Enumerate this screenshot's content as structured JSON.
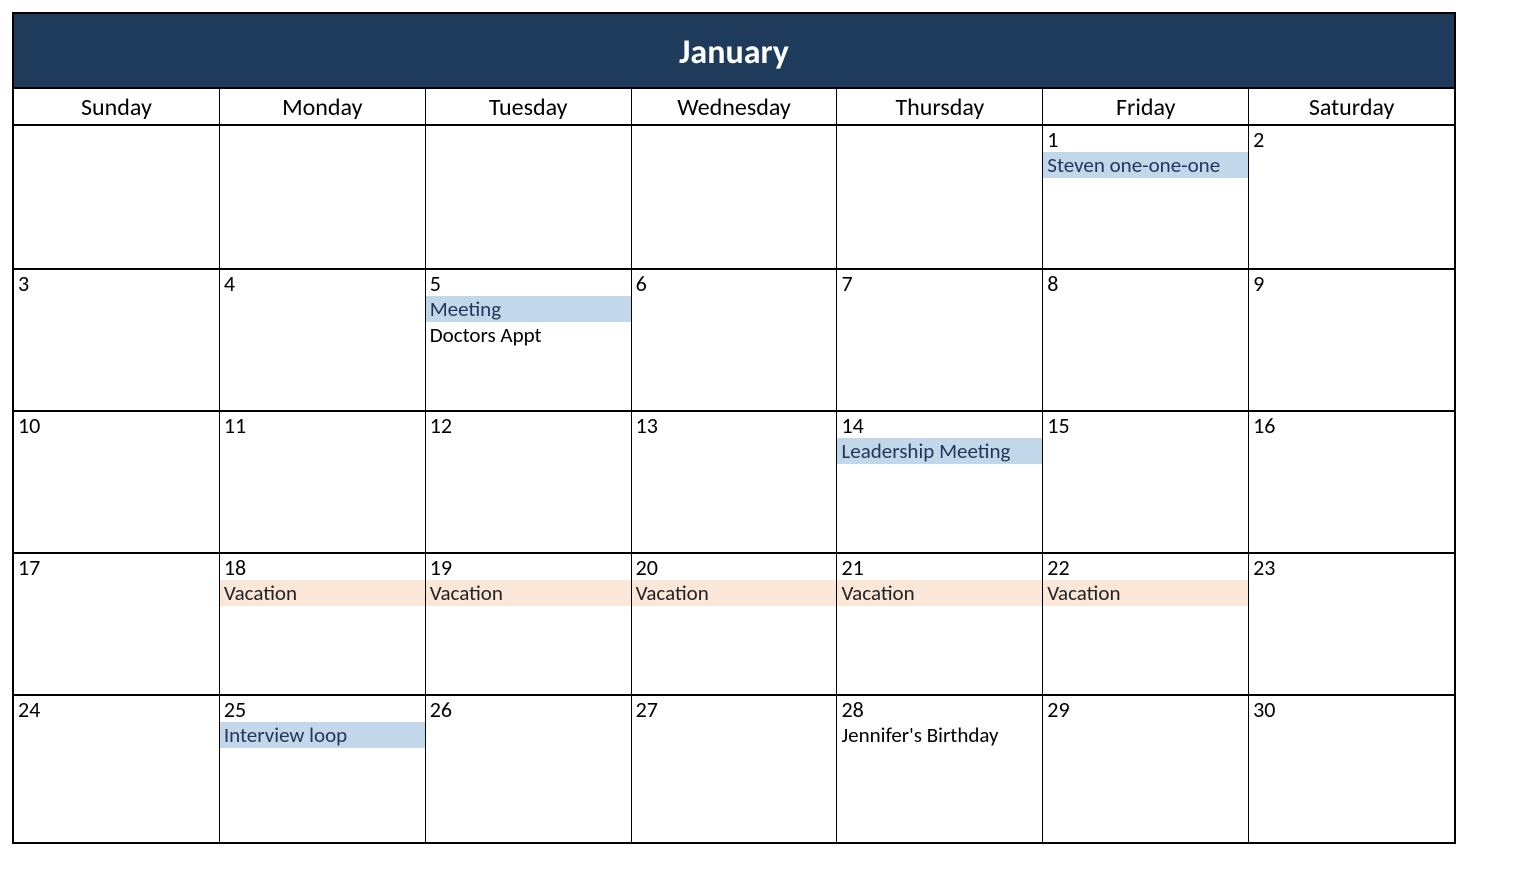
{
  "month_title": "January",
  "day_names": [
    "Sunday",
    "Monday",
    "Tuesday",
    "Wednesday",
    "Thursday",
    "Friday",
    "Saturday"
  ],
  "weeks": [
    [
      {
        "num": "",
        "events": []
      },
      {
        "num": "",
        "events": []
      },
      {
        "num": "",
        "events": []
      },
      {
        "num": "",
        "events": []
      },
      {
        "num": "",
        "events": []
      },
      {
        "num": "1",
        "events": [
          {
            "label": "Steven one-one-one",
            "style": "blue"
          }
        ]
      },
      {
        "num": "2",
        "events": []
      }
    ],
    [
      {
        "num": "3",
        "events": []
      },
      {
        "num": "4",
        "events": []
      },
      {
        "num": "5",
        "events": [
          {
            "label": "Meeting",
            "style": "blue"
          },
          {
            "label": "Doctors Appt",
            "style": "plain"
          }
        ]
      },
      {
        "num": "6",
        "events": []
      },
      {
        "num": "7",
        "events": []
      },
      {
        "num": "8",
        "events": []
      },
      {
        "num": "9",
        "events": []
      }
    ],
    [
      {
        "num": "10",
        "events": []
      },
      {
        "num": "11",
        "events": []
      },
      {
        "num": "12",
        "events": []
      },
      {
        "num": "13",
        "events": []
      },
      {
        "num": "14",
        "events": [
          {
            "label": "Leadership Meeting",
            "style": "blue"
          }
        ]
      },
      {
        "num": "15",
        "events": []
      },
      {
        "num": "16",
        "events": []
      }
    ],
    [
      {
        "num": "17",
        "events": []
      },
      {
        "num": "18",
        "events": [
          {
            "label": "Vacation",
            "style": "peach"
          }
        ]
      },
      {
        "num": "19",
        "events": [
          {
            "label": "Vacation",
            "style": "peach"
          }
        ]
      },
      {
        "num": "20",
        "events": [
          {
            "label": "Vacation",
            "style": "peach"
          }
        ]
      },
      {
        "num": "21",
        "events": [
          {
            "label": "Vacation",
            "style": "peach"
          }
        ]
      },
      {
        "num": "22",
        "events": [
          {
            "label": "Vacation",
            "style": "peach"
          }
        ]
      },
      {
        "num": "23",
        "events": []
      }
    ],
    [
      {
        "num": "24",
        "events": []
      },
      {
        "num": "25",
        "events": [
          {
            "label": "Interview loop",
            "style": "blue"
          }
        ]
      },
      {
        "num": "26",
        "events": []
      },
      {
        "num": "27",
        "events": []
      },
      {
        "num": "28",
        "events": [
          {
            "label": "Jennifer's Birthday",
            "style": "plain"
          }
        ]
      },
      {
        "num": "29",
        "events": []
      },
      {
        "num": "30",
        "events": []
      }
    ]
  ]
}
